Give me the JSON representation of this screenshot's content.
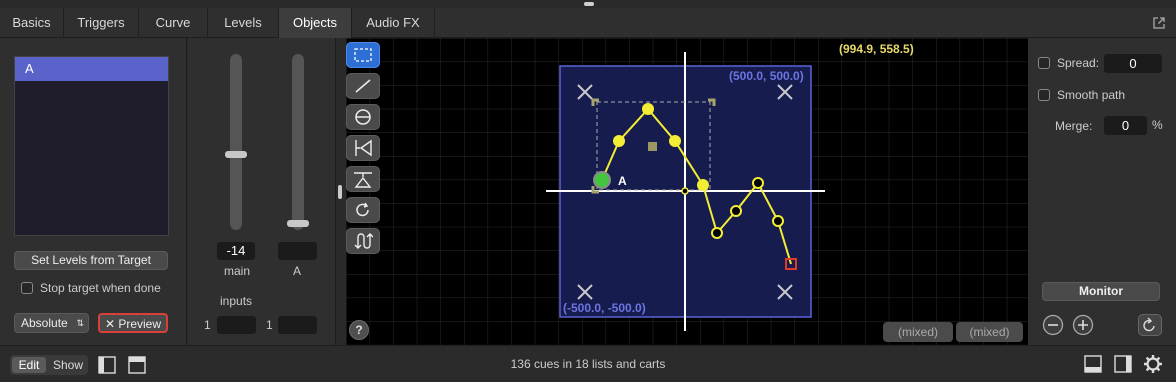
{
  "tabs": [
    "Basics",
    "Triggers",
    "Curve",
    "Levels",
    "Objects",
    "Audio FX"
  ],
  "active_tab": "Objects",
  "left_panel": {
    "list_items": [
      "A"
    ],
    "set_levels_label": "Set Levels from Target",
    "stop_target_label": "Stop target when done",
    "mode_value": "Absolute",
    "preview_label": "✕ Preview"
  },
  "levels": {
    "main_value": "-14",
    "main_label": "main",
    "a_value": "",
    "a_label": "A",
    "inputs_label": "inputs",
    "input1_label": "1",
    "input2_label": "1"
  },
  "canvas": {
    "cursor_coord": "(994.9, 558.5)",
    "top_right_coord": "(500.0, 500.0)",
    "bottom_left_coord": "(-500.0, -500.0)",
    "object_label": "A",
    "mixed_1": "(mixed)",
    "mixed_2": "(mixed)",
    "help_label": "?"
  },
  "right_panel": {
    "spread_label": "Spread:",
    "spread_value": "0",
    "smooth_label": "Smooth path",
    "merge_label": "Merge:",
    "merge_value": "0",
    "merge_unit": "%",
    "monitor_label": "Monitor"
  },
  "status": {
    "edit_label": "Edit",
    "show_label": "Show",
    "summary": "136 cues in 18 lists and carts"
  },
  "colors": {
    "accent_blue": "#2e6fd6",
    "path_yellow": "#f2ee35",
    "bounds_fill": "#171c4e",
    "preview_red": "#d9403a"
  }
}
